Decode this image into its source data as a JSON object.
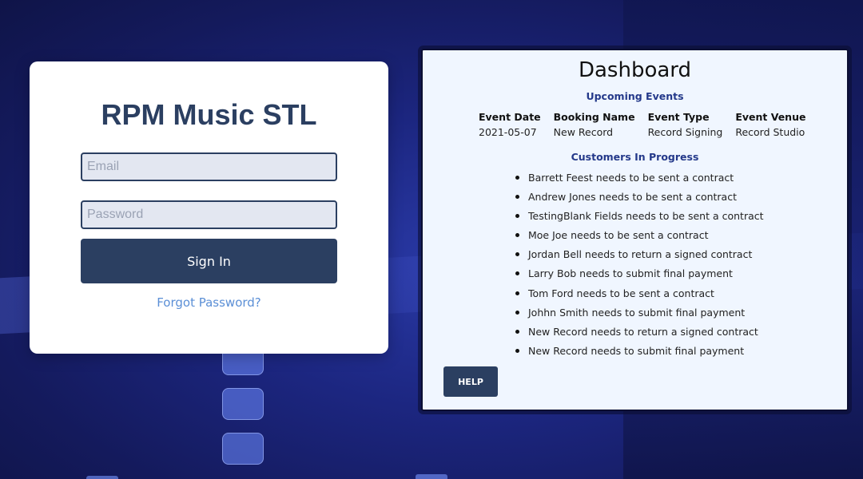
{
  "login": {
    "title": "RPM Music STL",
    "email_placeholder": "Email",
    "password_placeholder": "Password",
    "signin_label": "Sign In",
    "forgot_label": "Forgot Password?"
  },
  "dashboard": {
    "title": "Dashboard",
    "upcoming_heading": "Upcoming Events",
    "event_columns": [
      "Event Date",
      "Booking Name",
      "Event Type",
      "Event Venue"
    ],
    "events": [
      [
        "2021-05-07",
        "New Record",
        "Record Signing",
        "Record Studio"
      ]
    ],
    "customers_heading": "Customers In Progress",
    "customers": [
      "Barrett Feest needs to be sent a contract",
      "Andrew Jones needs to be sent a contract",
      "TestingBlank Fields needs to be sent a contract",
      "Moe Joe needs to be sent a contract",
      "Jordan Bell needs to return a signed contract",
      "Larry Bob needs to submit final payment",
      "Tom Ford needs to be sent a contract",
      "Johhn Smith needs to submit final payment",
      "New Record needs to return a signed contract",
      "New Record needs to submit final payment"
    ],
    "help_label": "HELP"
  },
  "colors": {
    "primary": "#2b3f61",
    "link": "#5b8fd6",
    "heading_accent": "#24398a",
    "dashboard_bg": "#f0f6ff"
  }
}
